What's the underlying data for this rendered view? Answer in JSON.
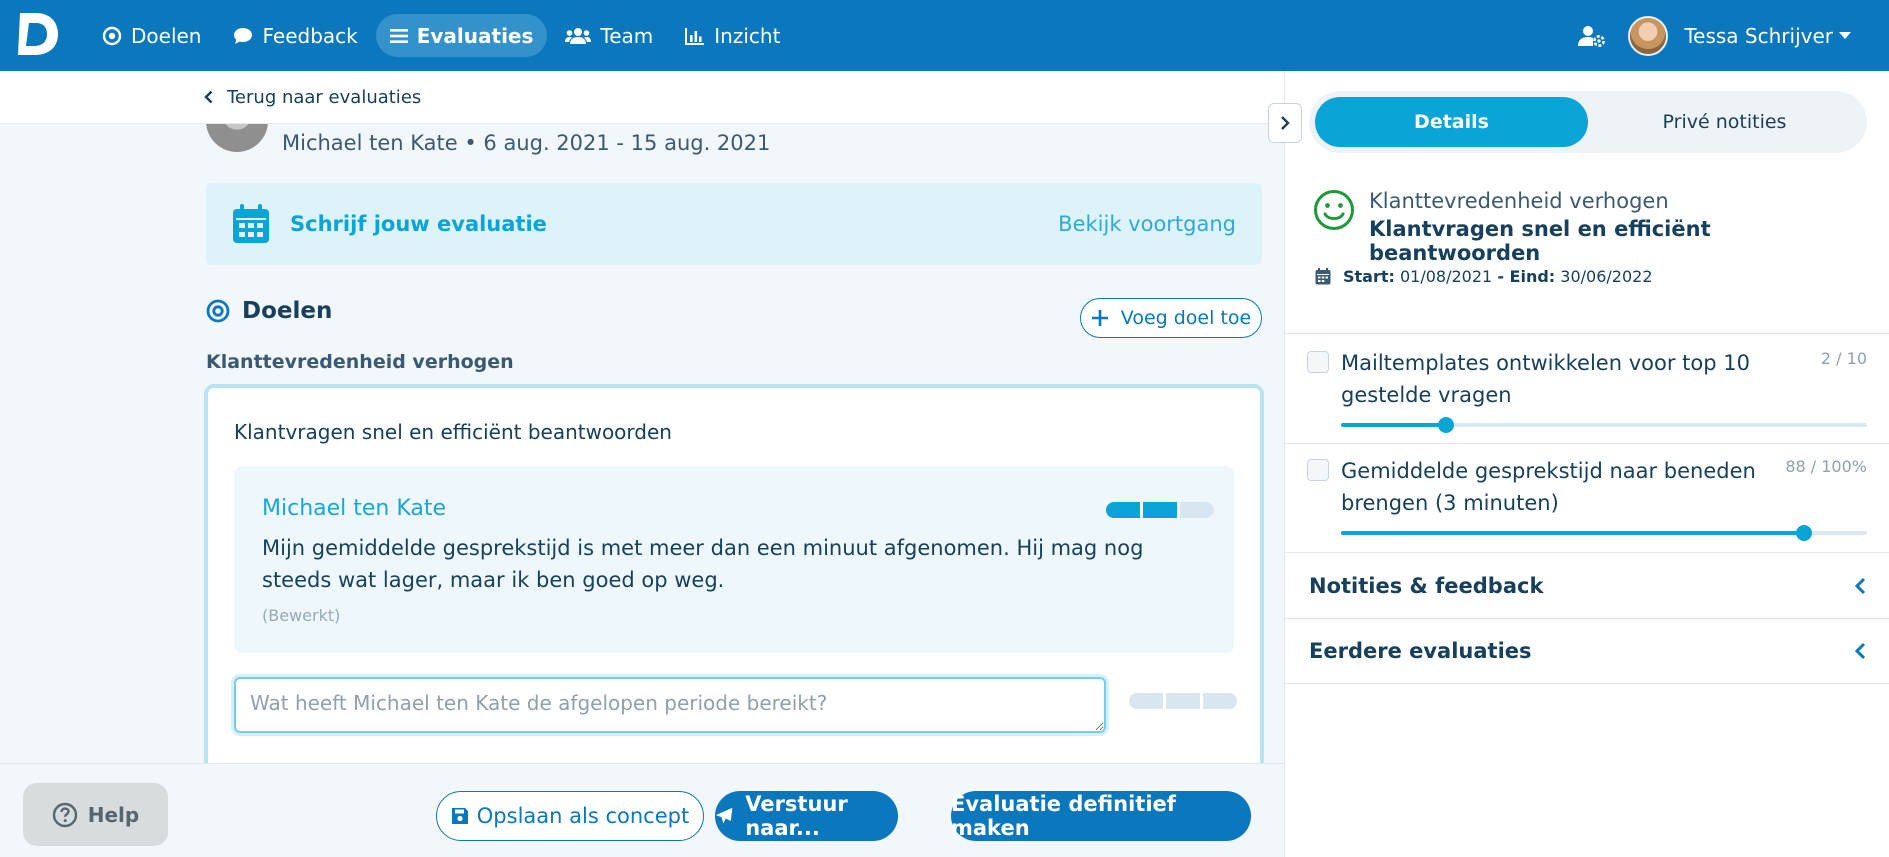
{
  "nav": {
    "items": [
      {
        "label": "Doelen",
        "icon": "target-icon"
      },
      {
        "label": "Feedback",
        "icon": "chat-bubble-icon"
      },
      {
        "label": "Evaluaties",
        "icon": "list-icon",
        "active": true
      },
      {
        "label": "Team",
        "icon": "users-icon"
      },
      {
        "label": "Inzicht",
        "icon": "bar-chart-icon"
      }
    ],
    "user_name": "Tessa Schrijver"
  },
  "main": {
    "back_label": "Terug naar evaluaties",
    "meta_text": "Michael ten Kate • 6 aug. 2021 - 15 aug. 2021",
    "banner": {
      "title": "Schrijf jouw evaluatie",
      "link": "Bekijk voortgang"
    },
    "goals_title": "Doelen",
    "add_goal_label": "Voeg doel toe",
    "goal_category": "Klanttevredenheid verhogen",
    "goal_card": {
      "title": "Klantvragen snel en efficiënt beantwoorden",
      "evaluation": {
        "author": "Michael ten Kate",
        "text": "Mijn gemiddelde gesprekstijd is met meer dan een minuut afgenomen. Hij mag nog steeds wat lager, maar ik ben goed op weg.",
        "edited": "(Bewerkt)",
        "rating_segments_filled": 2,
        "rating_segments_total": 3
      },
      "input_placeholder": "Wat heeft Michael ten Kate de afgelopen periode bereikt?",
      "input_rating_filled": 0
    }
  },
  "footer": {
    "help": "Help",
    "save_concept": "Opslaan als concept",
    "send": "Verstuur naar...",
    "finalize": "Evaluatie definitief maken"
  },
  "side": {
    "tabs": [
      "Details",
      "Privé notities"
    ],
    "goal_category": "Klanttevredenheid verhogen",
    "goal_title": "Klantvragen snel en efficiënt beantwoorden",
    "start_label": "Start:",
    "start_date": "01/08/2021",
    "end_label": "- Eind:",
    "end_date": "30/06/2022",
    "key_results": [
      {
        "title": "Mailtemplates ontwikkelen voor top 10 gestelde vragen",
        "score": "2 / 10",
        "progress": 0.2
      },
      {
        "title": "Gemiddelde gesprekstijd naar beneden brengen (3 minuten)",
        "score": "88 / 100%",
        "progress": 0.88
      }
    ],
    "sections": [
      "Notities & feedback",
      "Eerdere evaluaties"
    ]
  },
  "colors": {
    "primary": "#0b77bd",
    "accent": "#0aa4d6",
    "text": "#17405c",
    "success": "#1c9a3a"
  }
}
